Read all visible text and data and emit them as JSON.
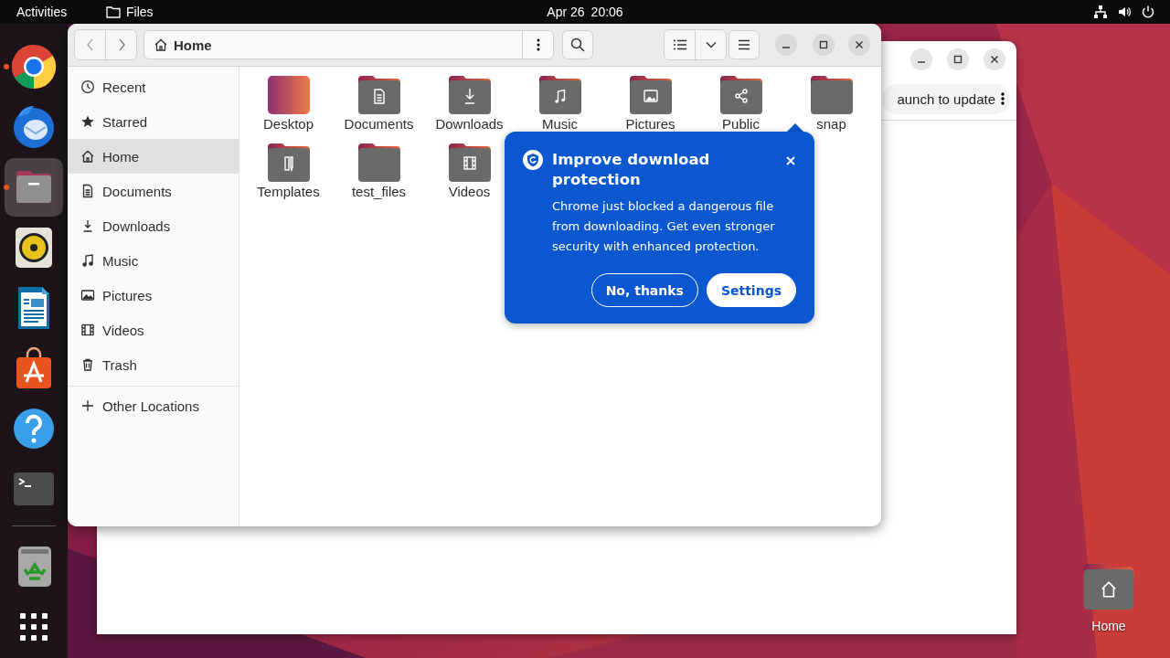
{
  "top_bar": {
    "activities": "Activities",
    "app_name": "Files",
    "date": "Apr 26",
    "time": "20:06"
  },
  "dock": {
    "items": [
      {
        "kind": "chrome",
        "running": true,
        "active": false
      },
      {
        "kind": "thunderbird",
        "running": false,
        "active": false
      },
      {
        "kind": "files",
        "running": true,
        "active": true
      },
      {
        "kind": "rhythmbox",
        "running": false,
        "active": false
      },
      {
        "kind": "writer",
        "running": false,
        "active": false
      },
      {
        "kind": "appcenter",
        "running": false,
        "active": false
      },
      {
        "kind": "help",
        "running": false,
        "active": false
      },
      {
        "kind": "terminal",
        "running": false,
        "active": false
      },
      {
        "kind": "separator"
      },
      {
        "kind": "trash",
        "running": false,
        "active": false
      },
      {
        "kind": "apps",
        "running": false,
        "active": false
      }
    ]
  },
  "chrome_window": {
    "omnibox_text": "aunch to update"
  },
  "files_window": {
    "path": "Home",
    "sidebar": {
      "items": [
        {
          "label": "Recent",
          "kind": "recent",
          "selected": false
        },
        {
          "label": "Starred",
          "kind": "starred",
          "selected": false
        },
        {
          "label": "Home",
          "kind": "home",
          "selected": true
        },
        {
          "label": "Documents",
          "kind": "documents",
          "selected": false
        },
        {
          "label": "Downloads",
          "kind": "downloads",
          "selected": false
        },
        {
          "label": "Music",
          "kind": "music",
          "selected": false
        },
        {
          "label": "Pictures",
          "kind": "pictures",
          "selected": false
        },
        {
          "label": "Videos",
          "kind": "videos",
          "selected": false
        },
        {
          "label": "Trash",
          "kind": "trash",
          "selected": false
        }
      ],
      "other_locations": "Other Locations"
    },
    "folders": [
      {
        "label": "Desktop",
        "kind": "desktop"
      },
      {
        "label": "Documents",
        "kind": "documents"
      },
      {
        "label": "Downloads",
        "kind": "downloads"
      },
      {
        "label": "Music",
        "kind": "music"
      },
      {
        "label": "Pictures",
        "kind": "pictures"
      },
      {
        "label": "Public",
        "kind": "public"
      },
      {
        "label": "snap",
        "kind": "plain"
      },
      {
        "label": "Templates",
        "kind": "templates"
      },
      {
        "label": "test_files",
        "kind": "plain"
      },
      {
        "label": "Videos",
        "kind": "videos"
      }
    ]
  },
  "popup": {
    "title": "Improve download protection",
    "body": "Chrome just blocked a dangerous file from downloading. Get even stronger security with enhanced protection.",
    "buttons": [
      {
        "label": "No, thanks",
        "kind": "outline"
      },
      {
        "label": "Settings",
        "kind": "filled"
      }
    ]
  },
  "desktop_icons": [
    {
      "label": "Home",
      "kind": "home"
    }
  ]
}
